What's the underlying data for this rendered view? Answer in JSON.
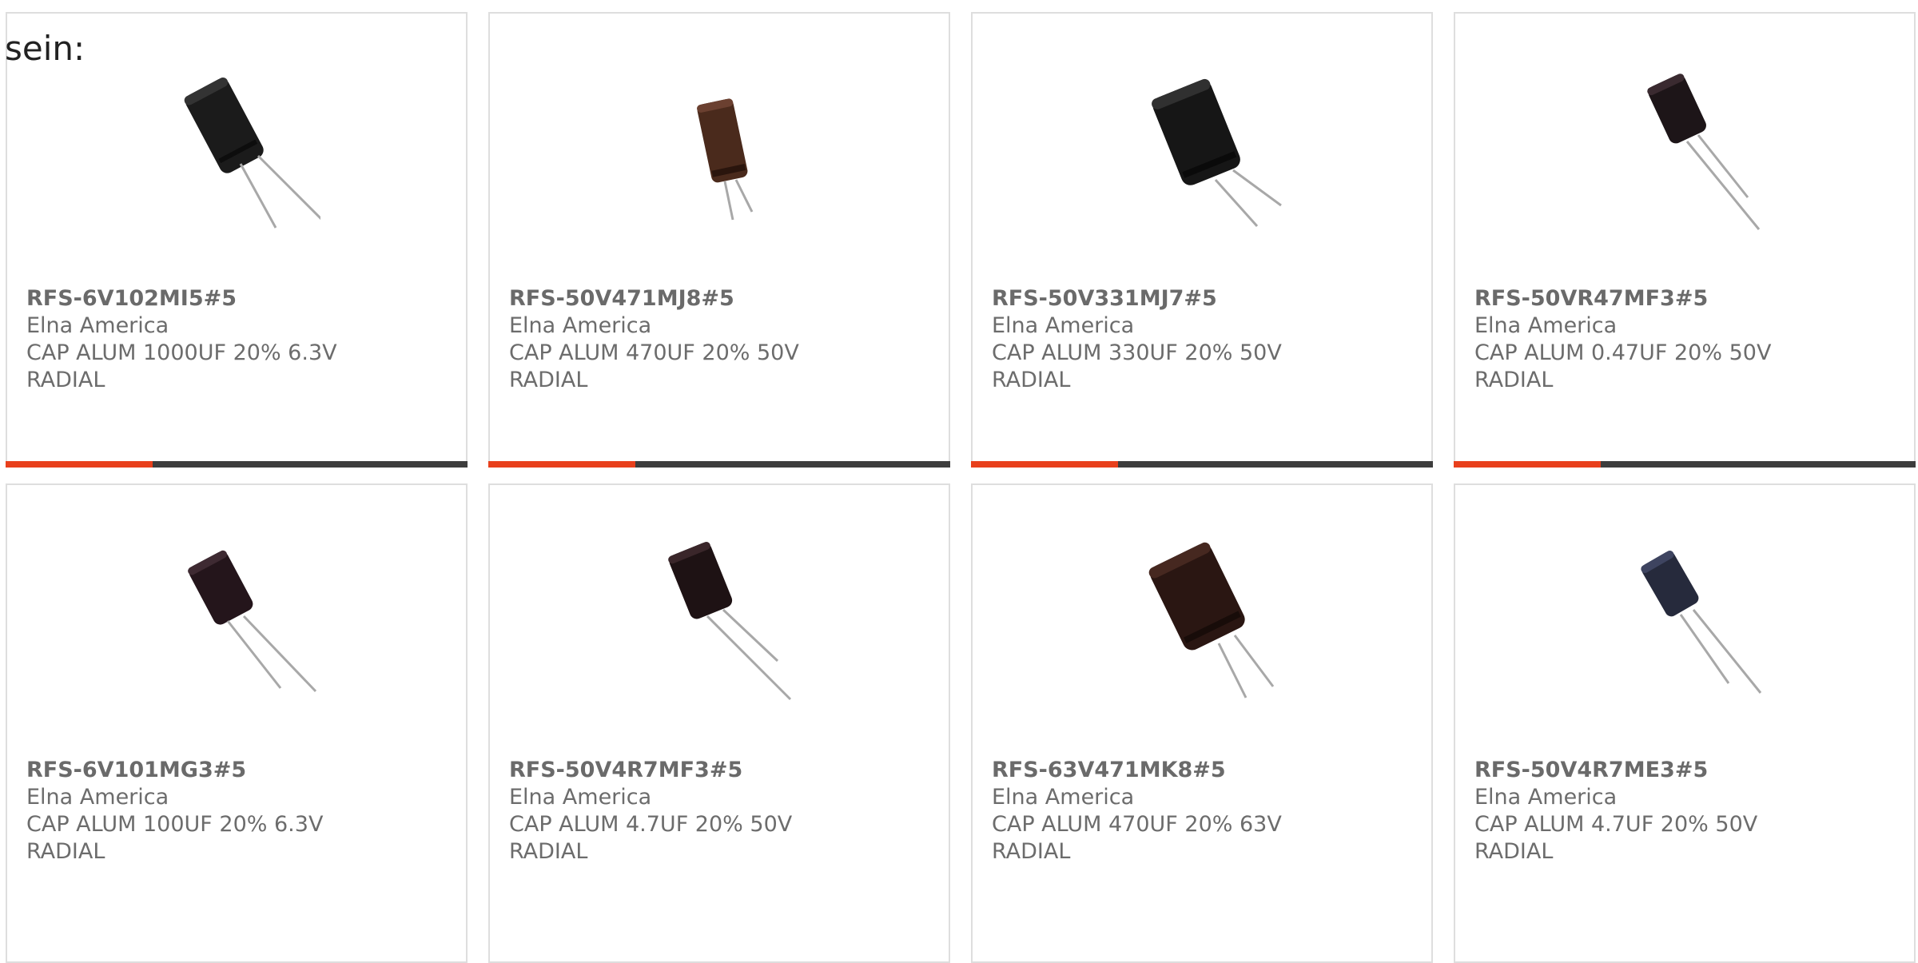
{
  "intro_text": "sein:",
  "colors": {
    "accent": "#e8401c",
    "bar": "#3d3d3d",
    "border": "#dedede",
    "text": "#6c6c6c"
  },
  "products": [
    {
      "part": "RFS-6V102MI5#5",
      "maker": "Elna America",
      "desc": "CAP ALUM 1000UF 20% 6.3V",
      "package": "RADIAL"
    },
    {
      "part": "RFS-50V471MJ8#5",
      "maker": "Elna America",
      "desc": "CAP ALUM 470UF 20% 50V",
      "package": "RADIAL"
    },
    {
      "part": "RFS-50V331MJ7#5",
      "maker": "Elna America",
      "desc": "CAP ALUM 330UF 20% 50V",
      "package": "RADIAL"
    },
    {
      "part": "RFS-50VR47MF3#5",
      "maker": "Elna America",
      "desc": "CAP ALUM 0.47UF 20% 50V",
      "package": "RADIAL"
    },
    {
      "part": "RFS-6V101MG3#5",
      "maker": "Elna America",
      "desc": "CAP ALUM 100UF 20% 6.3V",
      "package": "RADIAL"
    },
    {
      "part": "RFS-50V4R7MF3#5",
      "maker": "Elna America",
      "desc": "CAP ALUM 4.7UF 20% 50V",
      "package": "RADIAL"
    },
    {
      "part": "RFS-63V471MK8#5",
      "maker": "Elna America",
      "desc": "CAP ALUM 470UF 20% 63V",
      "package": "RADIAL"
    },
    {
      "part": "RFS-50V4R7ME3#5",
      "maker": "Elna America",
      "desc": "CAP ALUM 4.7UF 20% 50V",
      "package": "RADIAL"
    }
  ]
}
